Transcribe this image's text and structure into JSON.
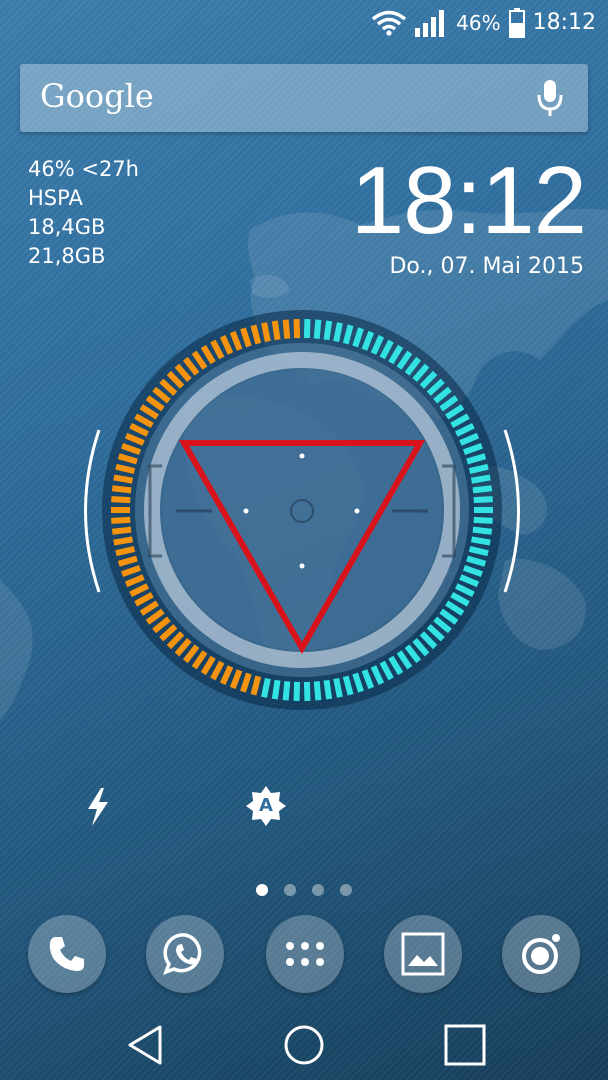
{
  "status_bar": {
    "battery_percent": "46%",
    "time": "18:12",
    "icons": [
      "wifi-icon",
      "signal-icon",
      "battery-icon"
    ]
  },
  "search": {
    "label": "Google",
    "icon": "mic-icon"
  },
  "stats": {
    "line1": "46% <27h",
    "line2": "HSPA",
    "line3": "18,4GB",
    "line4": "21,8GB"
  },
  "clock": {
    "time": "18:12",
    "date": "Do., 07. Mai 2015"
  },
  "ring": {
    "battery_level": 0.46,
    "colors": {
      "filled": "#f3930f",
      "remaining": "#33e3e3",
      "symbol": "#d8131b"
    }
  },
  "toggles": [
    "flash-icon",
    "auto-brightness-icon"
  ],
  "auto_brightness_label": "A",
  "pages": {
    "count": 4,
    "active": 1
  },
  "dock": [
    "phone-icon",
    "whatsapp-icon",
    "app-drawer-icon",
    "gallery-icon",
    "camera-icon"
  ],
  "nav": [
    "back-icon",
    "home-icon",
    "recents-icon"
  ]
}
